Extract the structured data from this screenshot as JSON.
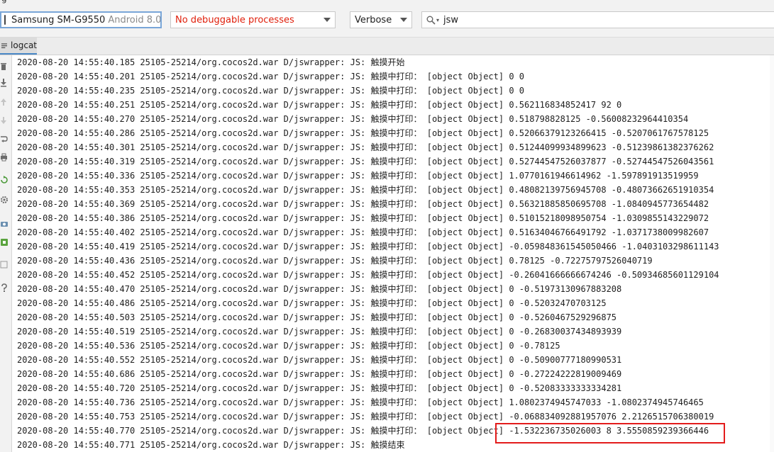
{
  "window": {
    "partial_title": "g"
  },
  "toolbar": {
    "device": {
      "name": "Samsung SM-G9550",
      "os": "Android 8.0"
    },
    "process": {
      "label": "No debuggable processes"
    },
    "log_level": {
      "value": "Verbose"
    },
    "search": {
      "value": "jsw"
    }
  },
  "tabs": [
    {
      "label": "logcat"
    }
  ],
  "gutter_icons": [
    "trash-icon",
    "scroll-to-end-icon",
    "up-icon",
    "down-icon",
    "soft-wrap-icon",
    "print-icon",
    "restart-icon",
    "settings-icon",
    "screenshot-icon",
    "screen-record-icon",
    "layout-icon",
    "help-icon"
  ],
  "log_lines": [
    "2020-08-20 14:55:40.185 25105-25214/org.cocos2d.war D/jswrapper: JS: 触摸开始",
    "2020-08-20 14:55:40.201 25105-25214/org.cocos2d.war D/jswrapper: JS: 触摸中打印： [object Object] 0 0",
    "2020-08-20 14:55:40.235 25105-25214/org.cocos2d.war D/jswrapper: JS: 触摸中打印： [object Object] 0 0",
    "2020-08-20 14:55:40.251 25105-25214/org.cocos2d.war D/jswrapper: JS: 触摸中打印： [object Object] 0.562116834852417 92 0",
    "2020-08-20 14:55:40.270 25105-25214/org.cocos2d.war D/jswrapper: JS: 触摸中打印： [object Object] 0.518798828125 -0.56008232964410354",
    "2020-08-20 14:55:40.286 25105-25214/org.cocos2d.war D/jswrapper: JS: 触摸中打印： [object Object] 0.52066379123266415 -0.5207061767578125",
    "2020-08-20 14:55:40.301 25105-25214/org.cocos2d.war D/jswrapper: JS: 触摸中打印： [object Object] 0.51244099934899623 -0.51239861382376262",
    "2020-08-20 14:55:40.319 25105-25214/org.cocos2d.war D/jswrapper: JS: 触摸中打印： [object Object] 0.52744547526037877 -0.52744547526043561",
    "2020-08-20 14:55:40.336 25105-25214/org.cocos2d.war D/jswrapper: JS: 触摸中打印： [object Object] 1.0770161946614962 -1.597891913519959",
    "2020-08-20 14:55:40.353 25105-25214/org.cocos2d.war D/jswrapper: JS: 触摸中打印： [object Object] 0.48082139756945708 -0.48073662651910354",
    "2020-08-20 14:55:40.369 25105-25214/org.cocos2d.war D/jswrapper: JS: 触摸中打印： [object Object] 0.56321885850695708 -1.0840945773654482",
    "2020-08-20 14:55:40.386 25105-25214/org.cocos2d.war D/jswrapper: JS: 触摸中打印： [object Object] 0.51015218098950754 -1.0309855143229072",
    "2020-08-20 14:55:40.402 25105-25214/org.cocos2d.war D/jswrapper: JS: 触摸中打印： [object Object] 0.51634046766491792 -1.0371738009982607",
    "2020-08-20 14:55:40.419 25105-25214/org.cocos2d.war D/jswrapper: JS: 触摸中打印： [object Object] -0.059848361545050466 -1.0403103298611143",
    "2020-08-20 14:55:40.436 25105-25214/org.cocos2d.war D/jswrapper: JS: 触摸中打印： [object Object] 0.78125 -0.72275797526040719",
    "2020-08-20 14:55:40.452 25105-25214/org.cocos2d.war D/jswrapper: JS: 触摸中打印： [object Object] -0.26041666666674246 -0.50934685601129104",
    "2020-08-20 14:55:40.470 25105-25214/org.cocos2d.war D/jswrapper: JS: 触摸中打印： [object Object] 0 -0.51973130967883208",
    "2020-08-20 14:55:40.486 25105-25214/org.cocos2d.war D/jswrapper: JS: 触摸中打印： [object Object] 0 -0.52032470703125",
    "2020-08-20 14:55:40.503 25105-25214/org.cocos2d.war D/jswrapper: JS: 触摸中打印： [object Object] 0 -0.5260467529296875",
    "2020-08-20 14:55:40.519 25105-25214/org.cocos2d.war D/jswrapper: JS: 触摸中打印： [object Object] 0 -0.26830037434893939",
    "2020-08-20 14:55:40.536 25105-25214/org.cocos2d.war D/jswrapper: JS: 触摸中打印： [object Object] 0 -0.78125",
    "2020-08-20 14:55:40.552 25105-25214/org.cocos2d.war D/jswrapper: JS: 触摸中打印： [object Object] 0 -0.50900777180990531",
    "2020-08-20 14:55:40.686 25105-25214/org.cocos2d.war D/jswrapper: JS: 触摸中打印： [object Object] 0 -0.27224222819009469",
    "2020-08-20 14:55:40.720 25105-25214/org.cocos2d.war D/jswrapper: JS: 触摸中打印： [object Object] 0 -0.52083333333334281",
    "2020-08-20 14:55:40.736 25105-25214/org.cocos2d.war D/jswrapper: JS: 触摸中打印： [object Object] 1.0802374945747033 -1.0802374945746465",
    "2020-08-20 14:55:40.753 25105-25214/org.cocos2d.war D/jswrapper: JS: 触摸中打印： [object Object] -0.068834092881957076 2.2126515706380019",
    "2020-08-20 14:55:40.770 25105-25214/org.cocos2d.war D/jswrapper: JS: 触摸中打印： [object Object] -1.532236735026003 8 3.5550859239366446",
    "2020-08-20 14:55:40.771 25105-25214/org.cocos2d.war D/jswrapper: JS: 触摸结束"
  ],
  "colors": {
    "highlight_box": "#e31c1c",
    "error_text": "#e0200c",
    "focus_border": "#79a6d8"
  }
}
